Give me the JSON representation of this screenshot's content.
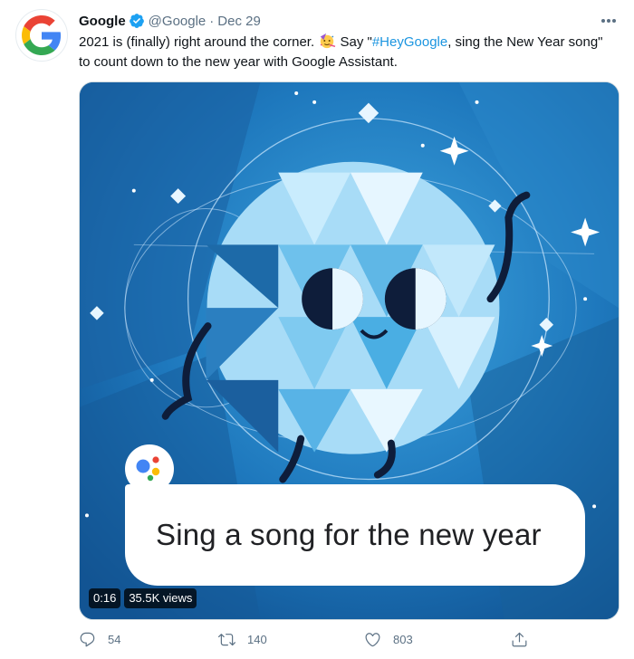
{
  "tweet": {
    "author_name": "Google",
    "handle": "@Google",
    "separator": "·",
    "date": "Dec 29",
    "text_part1": "2021 is (finally) right around the corner. ",
    "text_part2": " Say \"",
    "hashtag": "#HeyGoogle",
    "text_part3": ", sing the New Year song\" to count down to the new year with Google Assistant."
  },
  "media": {
    "bubble_text": "Sing a song for the new year",
    "duration": "0:16",
    "views": "35.5K views"
  },
  "actions": {
    "replies": "54",
    "retweets": "140",
    "likes": "803"
  },
  "icons": {
    "avatar": "google-g-logo",
    "verified": "verified-badge-icon",
    "more": "more-icon",
    "emoji": "party-face-emoji",
    "reply": "reply-icon",
    "retweet": "retweet-icon",
    "like": "heart-icon",
    "share": "share-icon"
  },
  "colors": {
    "link": "#1b95e0",
    "muted": "#5b7083",
    "verified": "#1da1f2",
    "google_blue": "#4285f4",
    "google_red": "#ea4335",
    "google_yellow": "#fbbc05",
    "google_green": "#34a853"
  }
}
